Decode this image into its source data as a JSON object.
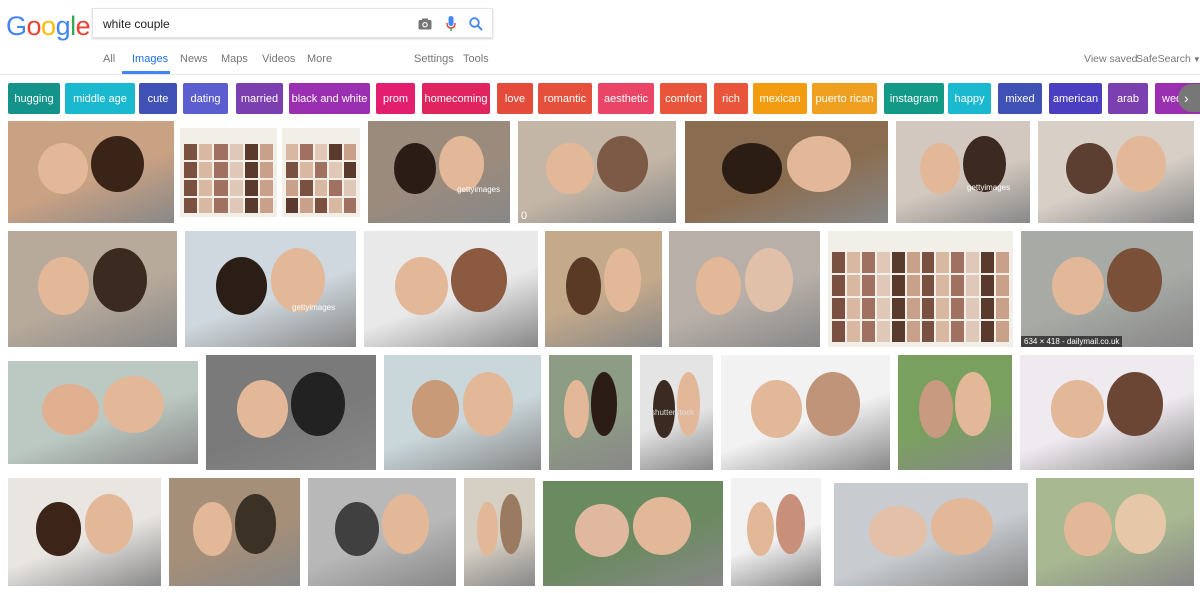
{
  "logo": {
    "text": "Google",
    "letters": [
      {
        "ch": "G",
        "color": "#4285f4"
      },
      {
        "ch": "o",
        "color": "#ea4335"
      },
      {
        "ch": "o",
        "color": "#fbbc05"
      },
      {
        "ch": "g",
        "color": "#4285f4"
      },
      {
        "ch": "l",
        "color": "#34a853"
      },
      {
        "ch": "e",
        "color": "#ea4335"
      }
    ]
  },
  "search": {
    "value": "white couple",
    "camera_icon": "camera-icon",
    "mic_icon": "microphone-icon",
    "search_icon": "search-icon"
  },
  "nav": {
    "all": "All",
    "images": "Images",
    "news": "News",
    "maps": "Maps",
    "videos": "Videos",
    "more": "More",
    "settings": "Settings",
    "tools": "Tools"
  },
  "right": {
    "view_saved": "View saved",
    "safesearch": "SafeSearch"
  },
  "chips": [
    {
      "label": "hugging",
      "color": "#13938a"
    },
    {
      "label": "middle age",
      "color": "#1ab9d0"
    },
    {
      "label": "cute",
      "color": "#3f51b5"
    },
    {
      "label": "dating",
      "color": "#5c5ed0"
    },
    {
      "label": "married",
      "color": "#7b3fb0"
    },
    {
      "label": "black and white",
      "color": "#9a2fb2"
    },
    {
      "label": "prom",
      "color": "#e31e6e"
    },
    {
      "label": "homecoming",
      "color": "#e0245f"
    },
    {
      "label": "love",
      "color": "#e54b3a"
    },
    {
      "label": "romantic",
      "color": "#e4503b"
    },
    {
      "label": "aesthetic",
      "color": "#ea4466"
    },
    {
      "label": "comfort",
      "color": "#e8553a"
    },
    {
      "label": "rich",
      "color": "#e8553a"
    },
    {
      "label": "mexican",
      "color": "#f39c12"
    },
    {
      "label": "puerto rican",
      "color": "#f0a020"
    },
    {
      "label": "instagram",
      "color": "#139a87"
    },
    {
      "label": "happy",
      "color": "#1ab9d0"
    },
    {
      "label": "mixed",
      "color": "#3f51b5"
    },
    {
      "label": "american",
      "color": "#4c3ec0"
    },
    {
      "label": "arab",
      "color": "#7b3fb0"
    },
    {
      "label": "wedding",
      "color": "#9a2fb2"
    }
  ],
  "results": {
    "caption_dailymail": "634 × 418 - dailymail.co.uk",
    "watermark_getty": "gettyimages",
    "watermark_shutterstock": "shutterstock",
    "small_zero": "0"
  }
}
